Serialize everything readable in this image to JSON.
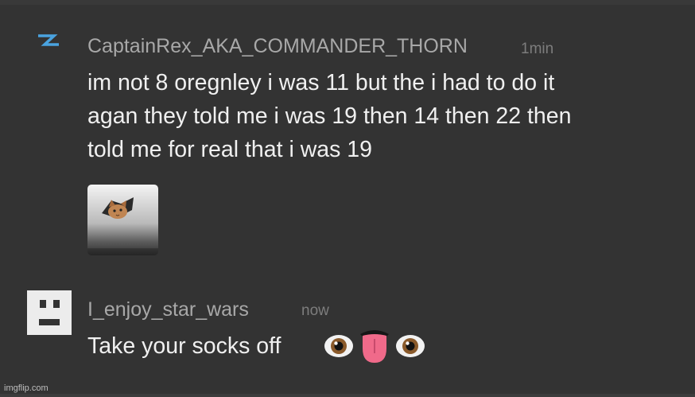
{
  "colors": {
    "background": "#333333",
    "username": "#a8a8a8",
    "timestamp": "#7d7d7d",
    "text": "#f0f0f0",
    "avatar_accent": "#4aa3e0"
  },
  "comments": [
    {
      "username": "CaptainRex_AKA_COMMANDER_THORN",
      "time": "1min",
      "lines": [
        "im not 8 oregnley i was 11 but the i had to do it",
        "agan they told me i was 19 then 14 then 22 then",
        "told me for real that i was 19"
      ],
      "avatar_icon": "lightning-bolt-icon",
      "attachment_icon": "ceiling-cat-thumbnail"
    },
    {
      "username": "I_enjoy_star_wars",
      "time": "now",
      "text": "Take your socks off",
      "avatar_icon": "blocky-face-icon",
      "emojis": [
        "eye-icon",
        "tongue-icon",
        "eye-icon"
      ]
    }
  ],
  "watermark": "imgflip.com"
}
